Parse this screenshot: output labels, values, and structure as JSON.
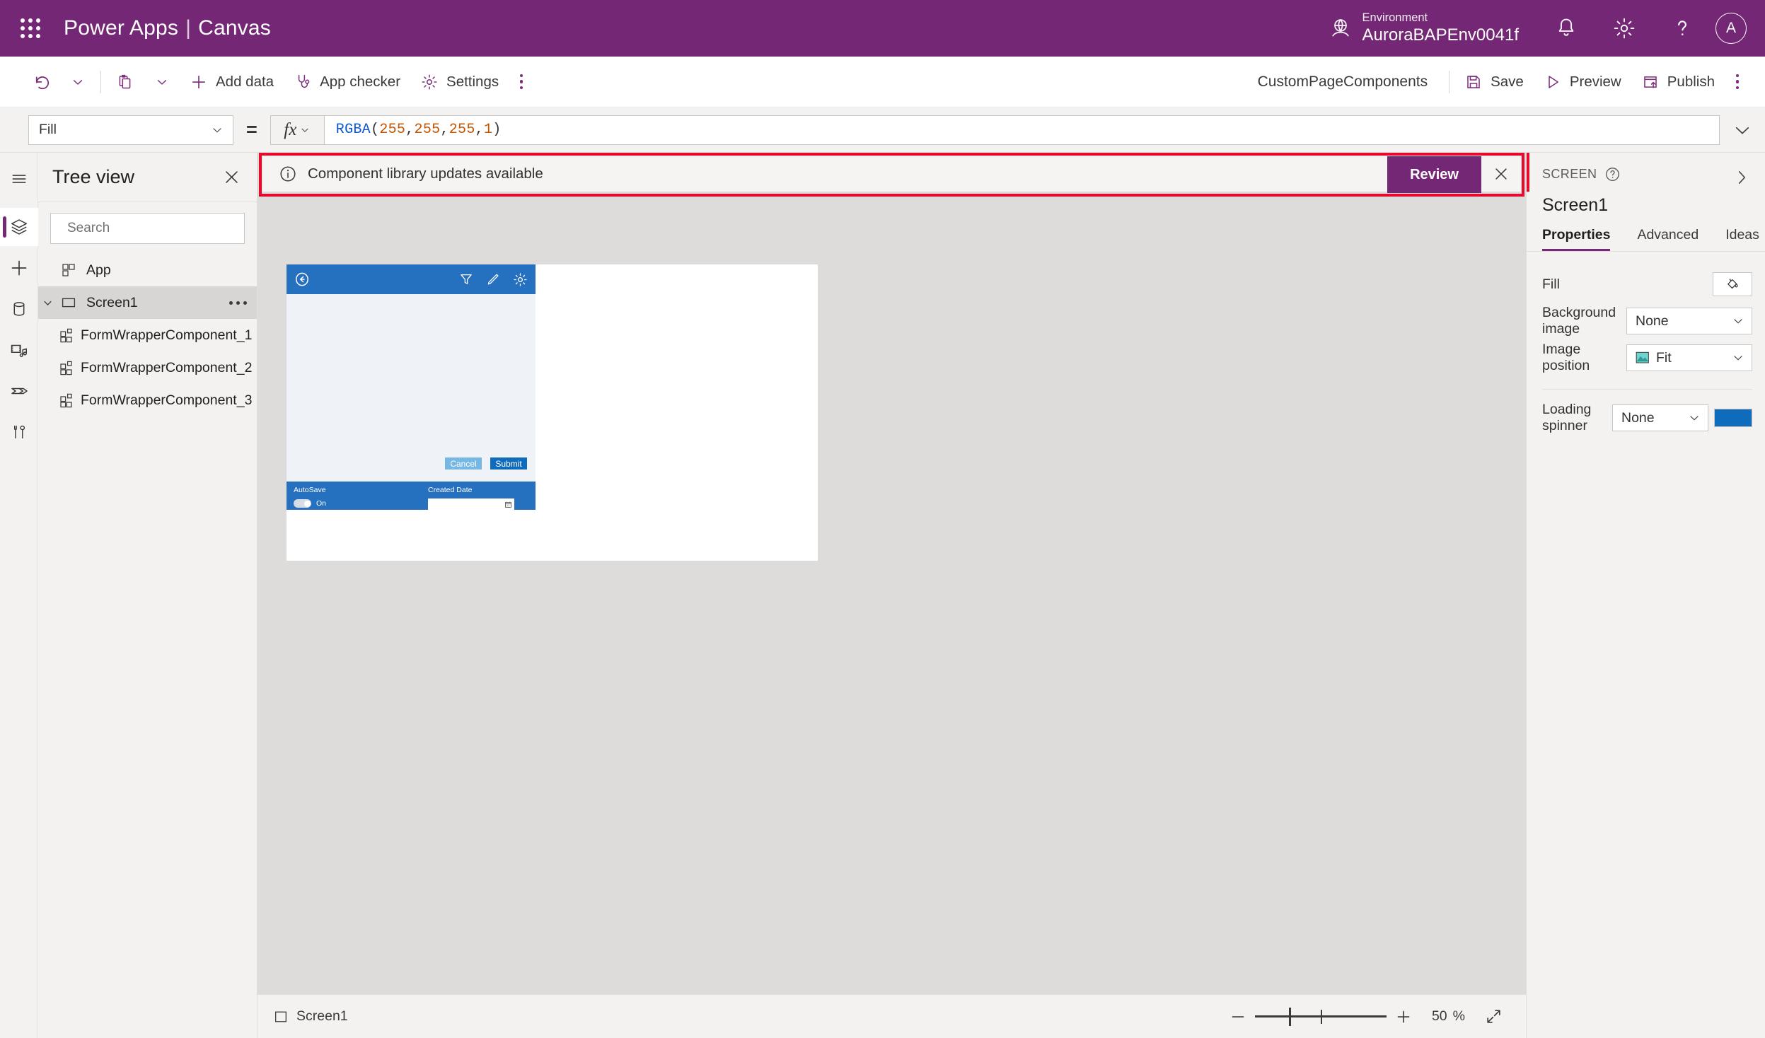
{
  "header": {
    "waffle_icon": "app-launcher-icon",
    "brand": "Power Apps",
    "brand_separator": "|",
    "brand_sub": "Canvas",
    "environment_label": "Environment",
    "environment_name": "AuroraBAPEnv0041f",
    "globe_icon": "globe-icon",
    "notifications_icon": "bell-icon",
    "settings_icon": "gear-icon",
    "help_icon": "question-icon",
    "avatar_initial": "A",
    "brand_color": "#742774"
  },
  "commandbar": {
    "undo_icon": "undo-icon",
    "paste_icon": "paste-icon",
    "add_data": "Add data",
    "app_checker": "App checker",
    "settings": "Settings",
    "overflow_icon": "more-icon",
    "app_name": "CustomPageComponents",
    "save": "Save",
    "preview": "Preview",
    "publish": "Publish",
    "overflow_right_icon": "more-icon"
  },
  "formulabar": {
    "property": "Fill",
    "equals": "=",
    "fx_label": "fx",
    "formula_tokens": [
      {
        "t": "RGBA",
        "k": "fn"
      },
      {
        "t": "(",
        "k": "pun"
      },
      {
        "t": "255",
        "k": "num"
      },
      {
        "t": ", ",
        "k": "pun"
      },
      {
        "t": "255",
        "k": "num"
      },
      {
        "t": ", ",
        "k": "pun"
      },
      {
        "t": "255",
        "k": "num"
      },
      {
        "t": ", ",
        "k": "pun"
      },
      {
        "t": "1",
        "k": "num"
      },
      {
        "t": ")",
        "k": "pun"
      }
    ],
    "expand_icon": "chevron-down-icon"
  },
  "rail": {
    "items": [
      {
        "name": "hamburger-icon",
        "active": false
      },
      {
        "name": "tree-view-icon",
        "active": true
      },
      {
        "name": "insert-icon",
        "active": false
      },
      {
        "name": "data-icon",
        "active": false
      },
      {
        "name": "media-icon",
        "active": false
      },
      {
        "name": "power-automate-icon",
        "active": false
      },
      {
        "name": "advanced-tools-icon",
        "active": false
      }
    ]
  },
  "treeview": {
    "title": "Tree view",
    "close_icon": "close-icon",
    "search_placeholder": "Search",
    "search_value": "",
    "search_icon": "search-icon",
    "nodes": [
      {
        "label": "App",
        "icon": "app-icon",
        "indent": 0,
        "selected": false,
        "expandable": false
      },
      {
        "label": "Screen1",
        "icon": "screen-icon",
        "indent": 0,
        "selected": true,
        "expandable": true,
        "more": true
      },
      {
        "label": "FormWrapperComponent_1",
        "icon": "component-icon",
        "indent": 1,
        "selected": false,
        "expandable": false
      },
      {
        "label": "FormWrapperComponent_2",
        "icon": "component-icon",
        "indent": 1,
        "selected": false,
        "expandable": false
      },
      {
        "label": "FormWrapperComponent_3",
        "icon": "component-icon",
        "indent": 1,
        "selected": false,
        "expandable": false
      }
    ]
  },
  "banner": {
    "info_icon": "info-icon",
    "message": "Component library updates available",
    "action_label": "Review",
    "close_icon": "close-icon",
    "highlight_color": "#e60a2e",
    "action_color": "#742774"
  },
  "canvas": {
    "app_preview": {
      "header_color": "#2670c0",
      "body_color": "#eff3f8",
      "back_icon": "back-arrow-icon",
      "filter_icon": "filter-icon",
      "edit_icon": "pencil-icon",
      "settings_icon": "gear-icon",
      "cancel_label": "Cancel",
      "submit_label": "Submit",
      "cancel_color": "#77b7e3",
      "submit_color": "#0f6cbd",
      "autosave_label": "AutoSave",
      "autosave_state": "On",
      "created_date_label": "Created Date",
      "created_date_value": "",
      "calendar_icon": "calendar-icon"
    }
  },
  "statusbar": {
    "screen_icon": "screen-icon",
    "screen_name": "Screen1",
    "zoom_out_icon": "minus-icon",
    "zoom_in_icon": "plus-icon",
    "zoom_value": "50",
    "zoom_unit": "%",
    "fit_icon": "fit-to-screen-icon"
  },
  "properties": {
    "kicker": "SCREEN",
    "help_icon": "question-circle-icon",
    "collapse_icon": "chevron-right-icon",
    "name": "Screen1",
    "tabs": [
      {
        "label": "Properties",
        "active": true
      },
      {
        "label": "Advanced",
        "active": false
      },
      {
        "label": "Ideas",
        "active": false
      }
    ],
    "rows": [
      {
        "label": "Fill",
        "control": "swatch",
        "icon": "fill-bucket-icon",
        "value": ""
      },
      {
        "label": "Background image",
        "control": "select",
        "value": "None"
      },
      {
        "label": "Image position",
        "control": "select-icon",
        "value": "Fit",
        "icon": "image-icon"
      },
      {
        "label": "Loading spinner",
        "control": "select-color",
        "value": "None",
        "color": "#0f6cbd"
      }
    ]
  }
}
